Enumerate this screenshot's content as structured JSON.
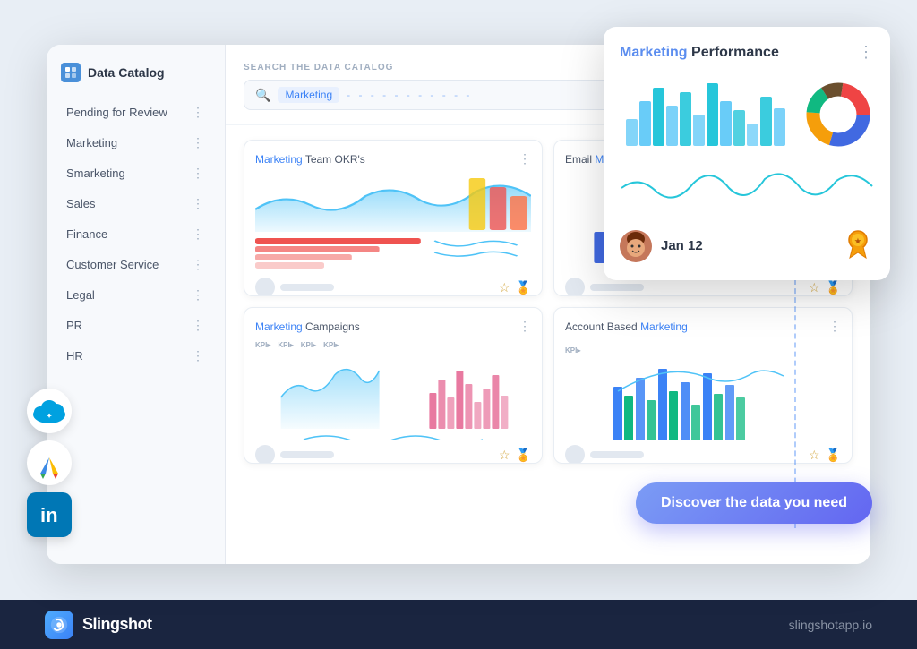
{
  "app": {
    "title": "Slingshot",
    "website": "slingshotapp.io"
  },
  "sidebar": {
    "header": "Data Catalog",
    "items": [
      {
        "label": "Pending for Review",
        "active": false
      },
      {
        "label": "Marketing",
        "active": false
      },
      {
        "label": "Smarketing",
        "active": false
      },
      {
        "label": "Sales",
        "active": false
      },
      {
        "label": "Finance",
        "active": false
      },
      {
        "label": "Customer Service",
        "active": false
      },
      {
        "label": "Legal",
        "active": false
      },
      {
        "label": "PR",
        "active": false
      },
      {
        "label": "HR",
        "active": false
      }
    ]
  },
  "search": {
    "label": "SEARCH THE DATA CATALOG",
    "tag": "Marketing",
    "placeholder": "Marketing"
  },
  "cards": [
    {
      "title_blue": "Marketing",
      "title_rest": " Team OKR's",
      "date": ""
    },
    {
      "title_blue": "Email",
      "title_rest": " Marketing",
      "date": ""
    },
    {
      "title_blue": "Marketing",
      "title_rest": " Campaigns",
      "date": ""
    },
    {
      "title_blue": "Account Based",
      "title_rest": " Marketing",
      "date": ""
    }
  ],
  "popup": {
    "title_blue": "Marketing",
    "title_rest": " Performance",
    "date": "Jan 12"
  },
  "discover_btn": "Discover the data you need"
}
